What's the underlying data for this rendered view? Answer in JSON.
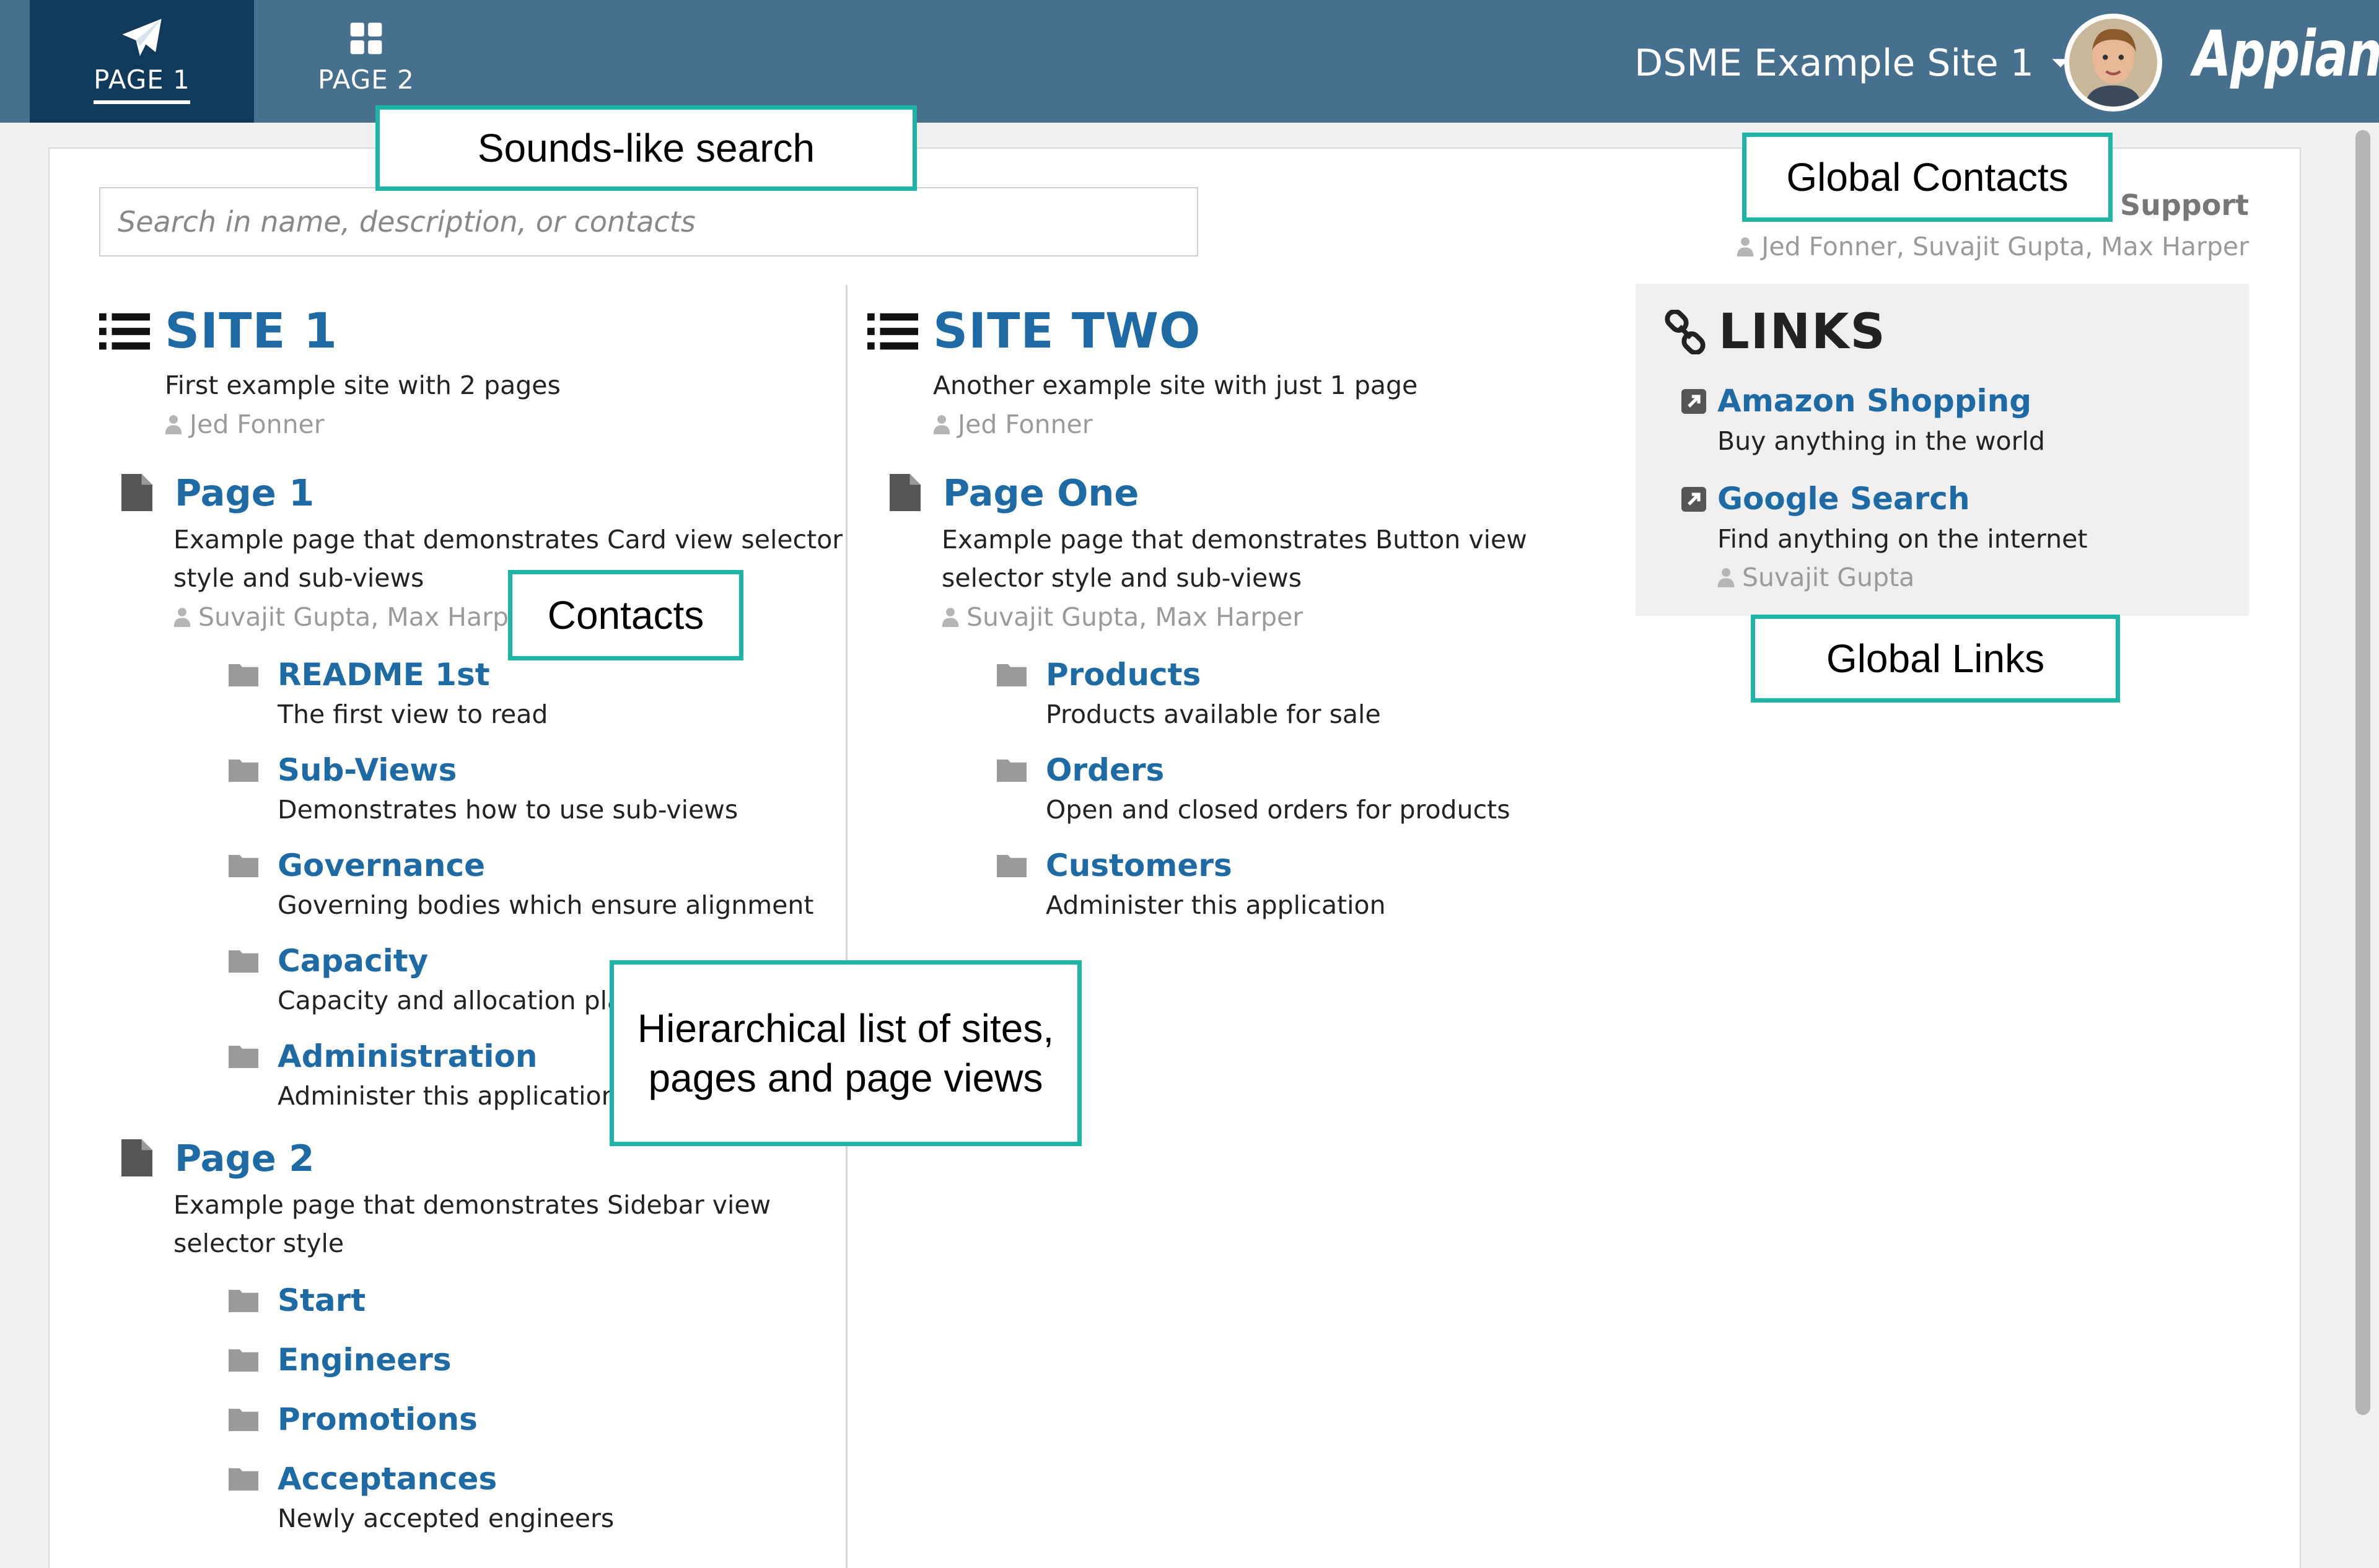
{
  "header": {
    "tabs": [
      {
        "label": "PAGE 1",
        "active": true,
        "icon": "paper-plane-icon"
      },
      {
        "label": "PAGE 2",
        "active": false,
        "icon": "grid-icon"
      }
    ],
    "site_selector": "DSME Example Site 1",
    "brand": "Appian",
    "colors": {
      "header": "#47708f",
      "active_tab": "#0f3a5c",
      "link": "#1d6aa5",
      "callout_border": "#1cb5a6"
    }
  },
  "search": {
    "placeholder": "Search in name, description, or contacts"
  },
  "support": {
    "title": "Support",
    "contacts": "Jed Fonner, Suvajit Gupta, Max Harper"
  },
  "sites": [
    {
      "title": "SITE 1",
      "description": "First example site with 2 pages",
      "contacts": "Jed Fonner",
      "pages": [
        {
          "title": "Page 1",
          "description": "Example page that demonstrates Card view selector style and sub-views",
          "contacts": "Suvajit Gupta, Max Harper",
          "views": [
            {
              "title": "README 1st",
              "description": "The first view to read"
            },
            {
              "title": "Sub-Views",
              "description": "Demonstrates how to use sub-views"
            },
            {
              "title": "Governance",
              "description": "Governing bodies which ensure alignment"
            },
            {
              "title": "Capacity",
              "description": "Capacity and allocation planning"
            },
            {
              "title": "Administration",
              "description": "Administer this application"
            }
          ]
        },
        {
          "title": "Page 2",
          "description": "Example page that demonstrates Sidebar view selector style",
          "views": [
            {
              "title": "Start"
            },
            {
              "title": "Engineers"
            },
            {
              "title": "Promotions"
            },
            {
              "title": "Acceptances",
              "description": "Newly accepted engineers"
            }
          ]
        }
      ]
    },
    {
      "title": "SITE TWO",
      "description": "Another example site with just 1 page",
      "contacts": "Jed Fonner",
      "pages": [
        {
          "title": "Page One",
          "description": "Example page that demonstrates Button view selector style and sub-views",
          "contacts": "Suvajit Gupta, Max Harper",
          "views": [
            {
              "title": "Products",
              "description": "Products available for sale"
            },
            {
              "title": "Orders",
              "description": "Open and closed orders for products"
            },
            {
              "title": "Customers",
              "description": "Administer this application"
            }
          ]
        }
      ]
    }
  ],
  "links": {
    "title": "LINKS",
    "items": [
      {
        "title": "Amazon Shopping",
        "description": "Buy anything in the world"
      },
      {
        "title": "Google Search",
        "description": "Find anything on the internet",
        "contacts": "Suvajit Gupta"
      }
    ]
  },
  "callouts": {
    "search": "Sounds-like search",
    "global_contacts": "Global Contacts",
    "contacts": "Contacts",
    "global_links": "Global Links",
    "hierarchy": "Hierarchical list of sites, pages and page views"
  }
}
